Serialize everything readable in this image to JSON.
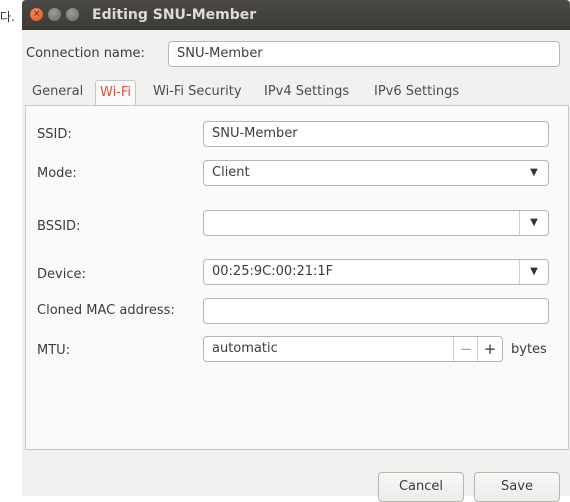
{
  "stray_text": "다.",
  "window": {
    "title": "Editing SNU-Member"
  },
  "connection": {
    "label": "Connection name:",
    "value": "SNU-Member"
  },
  "tabs": [
    {
      "label": "General"
    },
    {
      "label": "Wi-Fi",
      "active": true
    },
    {
      "label": "Wi-Fi Security"
    },
    {
      "label": "IPv4 Settings"
    },
    {
      "label": "IPv6 Settings"
    }
  ],
  "wifi": {
    "ssid": {
      "label": "SSID:",
      "value": "SNU-Member"
    },
    "mode": {
      "label": "Mode:",
      "value": "Client"
    },
    "bssid": {
      "label": "BSSID:",
      "value": ""
    },
    "device": {
      "label": "Device:",
      "value": "00:25:9C:00:21:1F"
    },
    "cloned_mac": {
      "label": "Cloned MAC address:",
      "value": ""
    },
    "mtu": {
      "label": "MTU:",
      "value": "automatic",
      "unit": "bytes",
      "minus": "−",
      "plus": "+"
    }
  },
  "buttons": {
    "cancel": "Cancel",
    "save": "Save"
  },
  "icons": {
    "dropdown": "▼",
    "close": "×"
  },
  "colors": {
    "active_tab": "#d8533a",
    "titlebar": "#3c3b37",
    "close_button": "#df4a16"
  }
}
